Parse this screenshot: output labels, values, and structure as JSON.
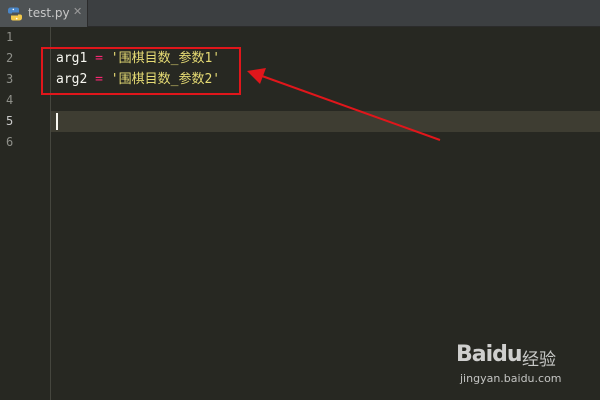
{
  "tab": {
    "filename": "test.py",
    "close_glyph": "✕",
    "icon": "python-file-icon"
  },
  "editor": {
    "line_numbers": [
      "1",
      "2",
      "3",
      "4",
      "5",
      "6"
    ],
    "current_line": "5",
    "lines": [
      {
        "name": "arg1",
        "op": "=",
        "value": "'围棋目数_参数1'"
      },
      {
        "name": "arg2",
        "op": "=",
        "value": "'围棋目数_参数2'"
      }
    ]
  },
  "annotation": {
    "box_color": "#e0161b",
    "arrow_color": "#e0161b"
  },
  "watermark": {
    "logo": "Baidu",
    "text": "经验",
    "url": "jingyan.baidu.com"
  }
}
